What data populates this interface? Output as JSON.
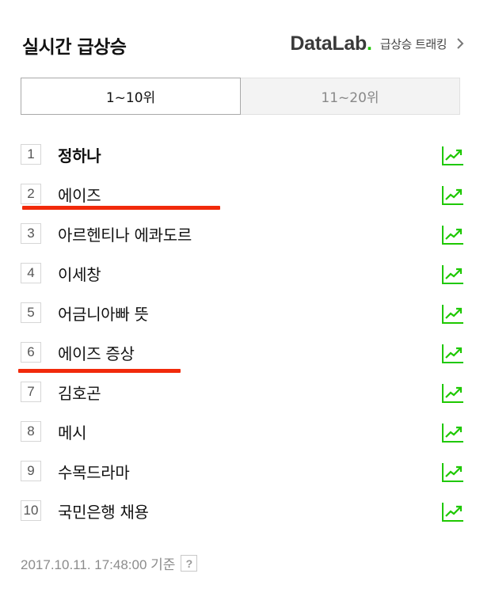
{
  "header": {
    "title": "실시간 급상승",
    "datalab_logo": "DataLab",
    "datalab_logo_dot": ".",
    "datalab_link_text": "급상승 트래킹",
    "chevron_icon": "chevron-right-icon"
  },
  "tabs": [
    {
      "label": "1~10위",
      "active": true
    },
    {
      "label": "11~20위",
      "active": false
    }
  ],
  "ranks": [
    {
      "rank": "1",
      "keyword": "정하나"
    },
    {
      "rank": "2",
      "keyword": "에이즈"
    },
    {
      "rank": "3",
      "keyword": "아르헨티나 에콰도르"
    },
    {
      "rank": "4",
      "keyword": "이세창"
    },
    {
      "rank": "5",
      "keyword": "어금니아빠 뜻"
    },
    {
      "rank": "6",
      "keyword": "에이즈 증상"
    },
    {
      "rank": "7",
      "keyword": "김호곤"
    },
    {
      "rank": "8",
      "keyword": "메시"
    },
    {
      "rank": "9",
      "keyword": "수목드라마"
    },
    {
      "rank": "10",
      "keyword": "국민은행 채용"
    }
  ],
  "trend_icon": "trend-chart-icon",
  "footer": {
    "timestamp": "2017.10.11. 17:48:00 기준",
    "help_label": "?"
  },
  "colors": {
    "accent_green": "#1ec800",
    "underline_red": "#f12a0b"
  }
}
